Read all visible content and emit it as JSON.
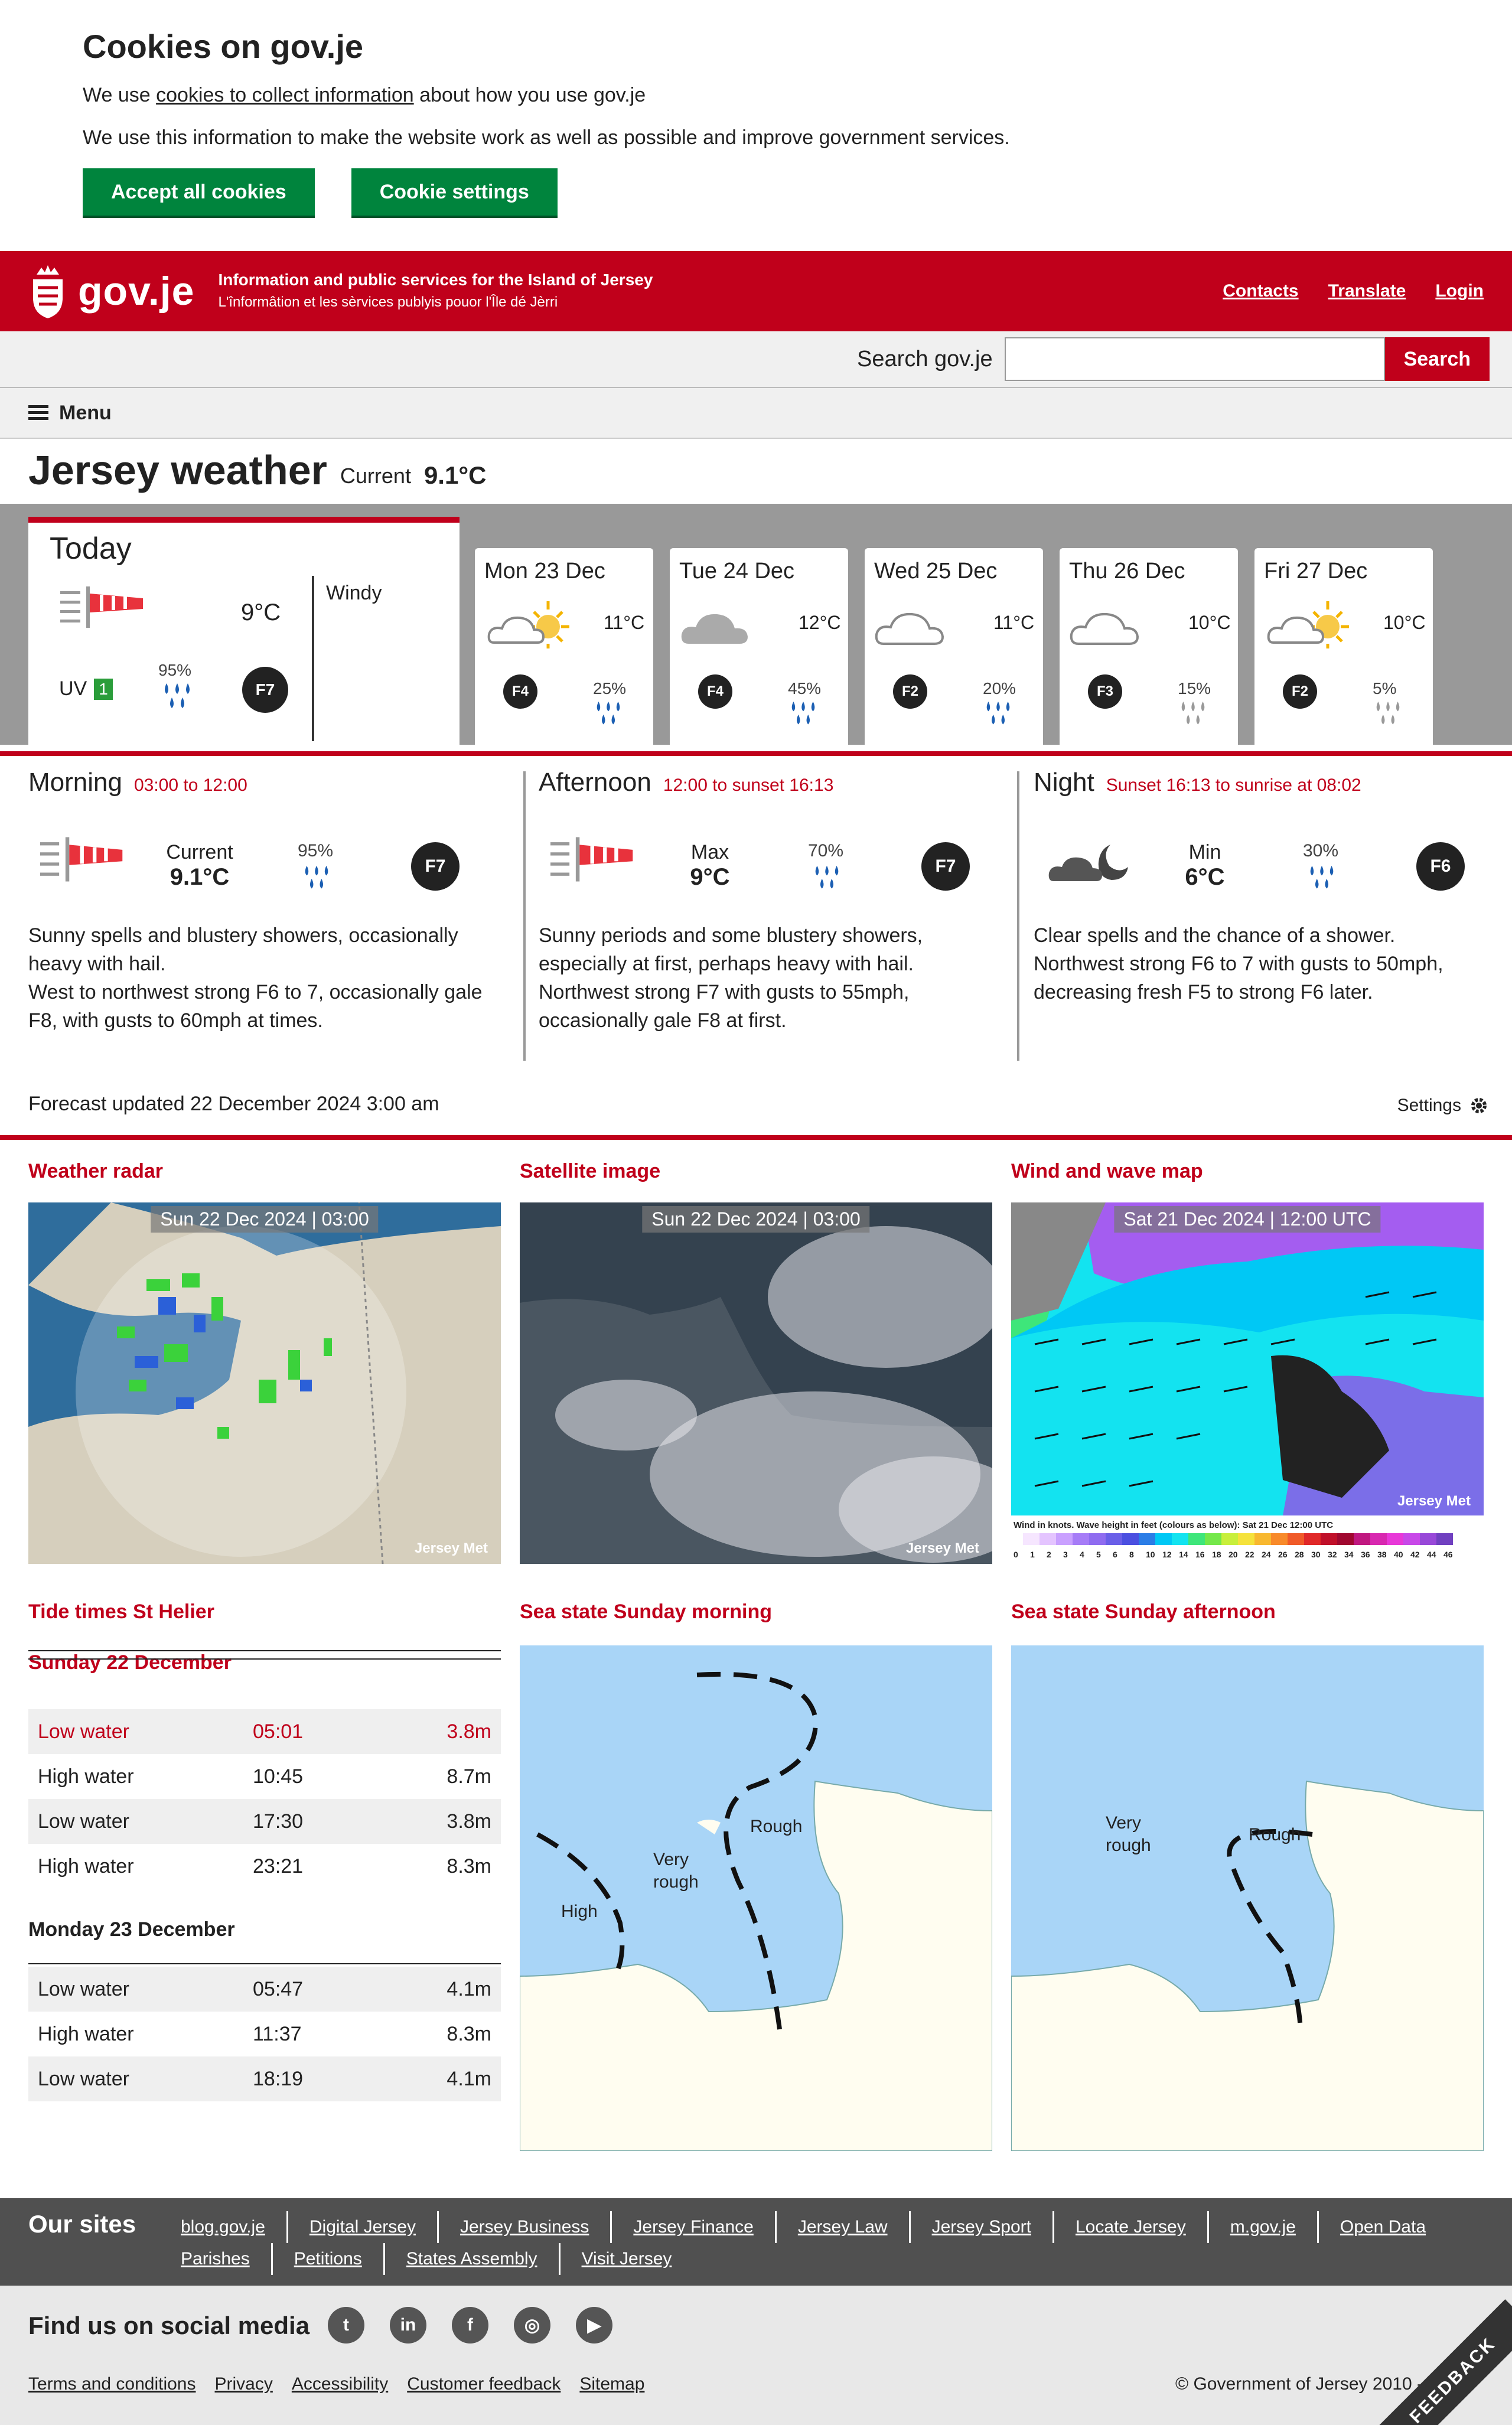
{
  "cookie": {
    "title": "Cookies on gov.je",
    "line1_pre": "We use ",
    "line1_link": "cookies to collect information",
    "line1_post": " about how you use gov.je",
    "line2": "We use this information to make the website work as well as possible and improve government services.",
    "accept_label": "Accept all cookies",
    "settings_label": "Cookie settings"
  },
  "header": {
    "logo_text": "gov.je",
    "tagline": "Information and public services for the Island of Jersey",
    "tagline_jerriais": "L'înformâtion et les sèrvices publyis pouor l'Île dé Jèrri",
    "links": [
      "Contacts",
      "Translate",
      "Login"
    ],
    "search_label": "Search gov.je",
    "search_button": "Search",
    "menu_label": "Menu"
  },
  "page": {
    "title": "Jersey weather",
    "current_label": "Current",
    "current_temp": "9.1°C"
  },
  "today": {
    "label": "Today",
    "temp": "9°C",
    "description": "Windy",
    "uv_label": "UV",
    "uv_value": "1",
    "rain": "95%",
    "force": "F7"
  },
  "days": [
    {
      "label": "Mon 23 Dec",
      "temp": "11°C",
      "rain": "25%",
      "force": "F4",
      "icon": "sun-cloud-icon"
    },
    {
      "label": "Tue 24 Dec",
      "temp": "12°C",
      "rain": "45%",
      "force": "F4",
      "icon": "cloud-icon"
    },
    {
      "label": "Wed 25 Dec",
      "temp": "11°C",
      "rain": "20%",
      "force": "F2",
      "icon": "cloud-icon"
    },
    {
      "label": "Thu 26 Dec",
      "temp": "10°C",
      "rain": "15%",
      "force": "F3",
      "icon": "cloud-icon"
    },
    {
      "label": "Fri 27 Dec",
      "temp": "10°C",
      "rain": "5%",
      "force": "F2",
      "icon": "sun-cloud-icon"
    }
  ],
  "periods": [
    {
      "title": "Morning",
      "time": "03:00 to 12:00",
      "temp_label": "Current",
      "temp": "9.1°C",
      "rain": "95%",
      "force": "F7",
      "text": "Sunny spells and blustery showers, occasionally heavy with hail.\nWest to northwest strong F6 to 7, occasionally gale F8, with gusts to 60mph at times."
    },
    {
      "title": "Afternoon",
      "time": "12:00 to sunset 16:13",
      "temp_label": "Max",
      "temp": "9°C",
      "rain": "70%",
      "force": "F7",
      "text": "Sunny periods and some blustery showers, especially at first, perhaps heavy with hail.\nNorthwest strong F7 with gusts to 55mph, occasionally gale F8 at first."
    },
    {
      "title": "Night",
      "time": "Sunset 16:13 to sunrise at 08:02",
      "temp_label": "Min",
      "temp": "6°C",
      "rain": "30%",
      "force": "F6",
      "text": "Clear spells and the chance of a shower.\nNorthwest strong F6 to 7 with gusts to 50mph, decreasing fresh F5 to strong F6 later."
    }
  ],
  "forecast_updated": "Forecast updated 22 December 2024 3:00 am",
  "settings_label": "Settings",
  "images": {
    "radar_title": "Weather radar",
    "radar_stamp": "Sun 22 Dec 2024 | 03:00",
    "satellite_title": "Satellite image",
    "satellite_stamp": "Sun 22 Dec 2024 | 03:00",
    "wind_title": "Wind and wave map",
    "wind_stamp": "Sat 21 Dec 2024 | 12:00 UTC",
    "wind_caption": "Wind in knots. Wave height in feet (colours as below): Sat 21 Dec 12:00 UTC",
    "wind_scale": [
      "0",
      "1",
      "2",
      "3",
      "4",
      "5",
      "6",
      "8",
      "10",
      "12",
      "14",
      "16",
      "18",
      "20",
      "22",
      "24",
      "26",
      "28",
      "30",
      "32",
      "34",
      "36",
      "38",
      "40",
      "42",
      "44",
      "46"
    ],
    "watermark": "Jersey Met"
  },
  "tides": {
    "title": "Tide times St Helier",
    "day1": "Sunday 22 December",
    "day1_rows": [
      [
        "Low water",
        "05:01",
        "3.8m"
      ],
      [
        "High water",
        "10:45",
        "8.7m"
      ],
      [
        "Low water",
        "17:30",
        "3.8m"
      ],
      [
        "High water",
        "23:21",
        "8.3m"
      ]
    ],
    "day2": "Monday 23 December",
    "day2_rows": [
      [
        "Low water",
        "05:47",
        "4.1m"
      ],
      [
        "High water",
        "11:37",
        "8.3m"
      ],
      [
        "Low water",
        "18:19",
        "4.1m"
      ]
    ]
  },
  "sea": {
    "morning_title": "Sea state Sunday morning",
    "afternoon_title": "Sea state Sunday afternoon",
    "m_labels": [
      "High",
      "Very rough",
      "Rough"
    ],
    "a_labels": [
      "Very rough",
      "Rough"
    ]
  },
  "footer": {
    "our_sites": "Our sites",
    "sites": [
      "blog.gov.je",
      "Digital Jersey",
      "Jersey Business",
      "Jersey Finance",
      "Jersey Law",
      "Jersey Sport",
      "Locate Jersey",
      "m.gov.je",
      "Open Data"
    ],
    "sites2": [
      "Parishes",
      "Petitions",
      "States Assembly",
      "Visit Jersey"
    ],
    "social_title": "Find us on social media",
    "links": [
      "Terms and conditions",
      "Privacy",
      "Accessibility",
      "Customer feedback",
      "Sitemap"
    ],
    "copyright": "© Government of Jersey 2010 - 2",
    "feedback": "FEEDBACK"
  }
}
